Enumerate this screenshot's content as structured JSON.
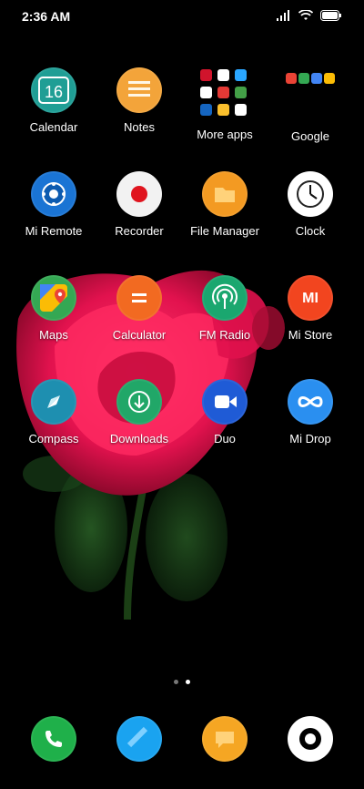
{
  "status_bar": {
    "time": "2:36 AM",
    "icons": [
      "signal-icon",
      "wifi-icon",
      "battery-icon"
    ]
  },
  "apps": [
    {
      "label": "Calendar",
      "icon": "calendar-icon",
      "color": "#1f9e95",
      "detail": "16"
    },
    {
      "label": "Notes",
      "icon": "notes-icon",
      "color": "#f3a43a"
    },
    {
      "label": "More apps",
      "icon": "folder-icon",
      "color": "#ffffff"
    },
    {
      "label": "Google",
      "icon": "google-folder-icon",
      "color": "#ffffff"
    },
    {
      "label": "Mi Remote",
      "icon": "remote-icon",
      "color": "#1a74d4"
    },
    {
      "label": "Recorder",
      "icon": "recorder-icon",
      "color": "#f2f2f2"
    },
    {
      "label": "File Manager",
      "icon": "file-manager-icon",
      "color": "#f39a22"
    },
    {
      "label": "Clock",
      "icon": "clock-icon",
      "color": "#ffffff"
    },
    {
      "label": "Maps",
      "icon": "maps-icon",
      "color": "#34a853"
    },
    {
      "label": "Calculator",
      "icon": "calculator-icon",
      "color": "#f26a21"
    },
    {
      "label": "FM Radio",
      "icon": "radio-icon",
      "color": "#1aa76f"
    },
    {
      "label": "Mi Store",
      "icon": "mi-store-icon",
      "color": "#f2451f",
      "detail": "MI"
    },
    {
      "label": "Compass",
      "icon": "compass-icon",
      "color": "#1e8fb0"
    },
    {
      "label": "Downloads",
      "icon": "downloads-icon",
      "color": "#21a768"
    },
    {
      "label": "Duo",
      "icon": "duo-icon",
      "color": "#1f5bd6"
    },
    {
      "label": "Mi Drop",
      "icon": "mi-drop-icon",
      "color": "#2a8ff0"
    }
  ],
  "dock": [
    {
      "name": "phone",
      "icon": "phone-icon",
      "color": "#1fb04a"
    },
    {
      "name": "messages",
      "icon": "messages-icon",
      "color": "#1aa3f0"
    },
    {
      "name": "chat",
      "icon": "chat-icon",
      "color": "#f5a623"
    },
    {
      "name": "camera",
      "icon": "camera-icon",
      "color": "#ffffff"
    }
  ],
  "pages": {
    "count": 2,
    "active": 2
  }
}
